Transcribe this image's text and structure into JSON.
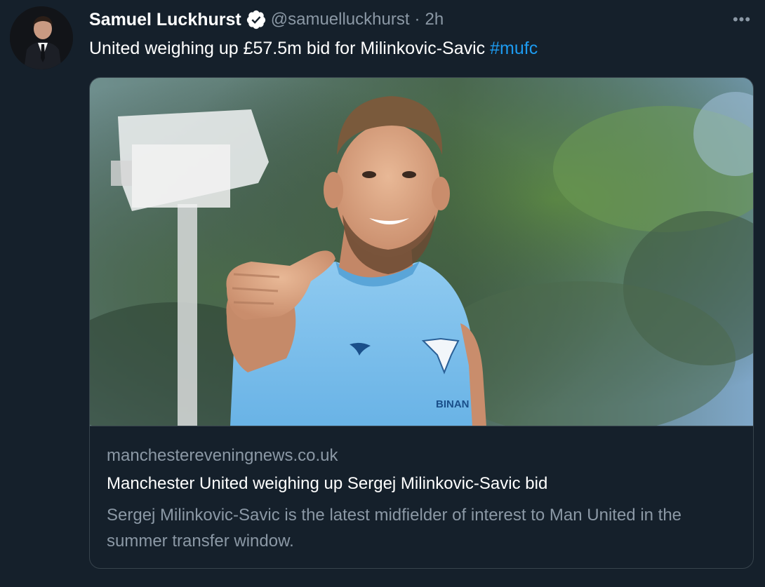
{
  "tweet": {
    "author_name": "Samuel Luckhurst",
    "author_handle": "@samuelluckhurst",
    "separator": "·",
    "time": "2h",
    "text": "United weighing up £57.5m bid for Milinkovic-Savic",
    "hashtag": "#mufc",
    "more_label": "•••"
  },
  "card": {
    "domain": "manchestereveningnews.co.uk",
    "title": "Manchester United weighing up Sergej Milinkovic-Savic bid",
    "description": "Sergej Milinkovic-Savic is the latest midfielder of interest to Man United in the summer transfer window.",
    "shirt_sponsor_text": "BINAN"
  },
  "colors": {
    "background": "#15202b",
    "secondary_text": "#8b98a5",
    "hashtag": "#1d9bf0",
    "verified_badge": "#ffffff"
  },
  "icons": {
    "verified": "verified-badge-icon",
    "more": "more-options-icon"
  }
}
